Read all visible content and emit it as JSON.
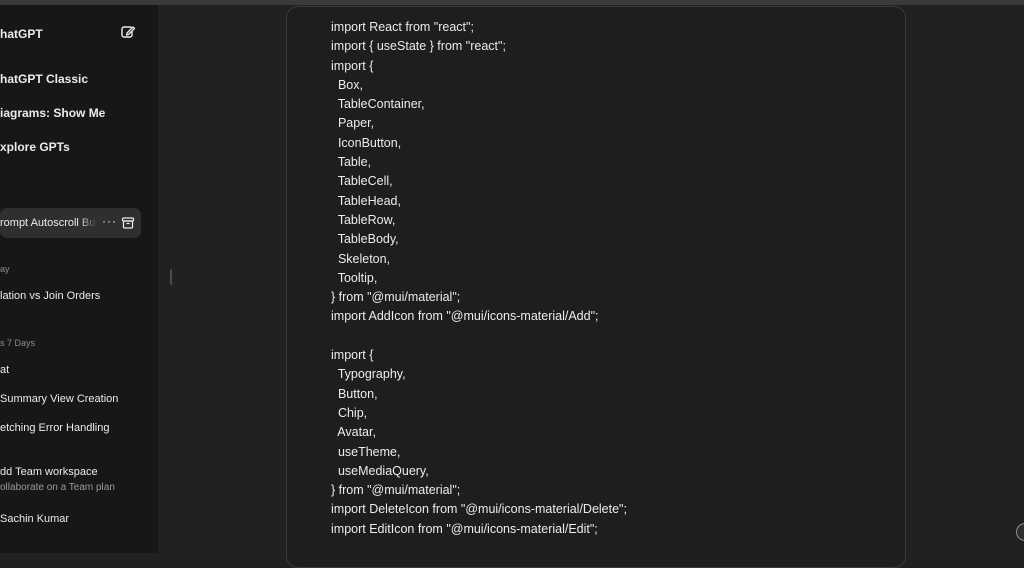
{
  "sidebar": {
    "title": "hatGPT",
    "new_chat_icon": "edit-icon",
    "gpts": [
      {
        "label": "hatGPT Classic"
      },
      {
        "label": "iagrams: Show Me"
      },
      {
        "label": "xplore GPTs"
      }
    ],
    "active_chat": {
      "label": "rompt Autoscroll Bu",
      "more": "···",
      "archive_icon": "archive-icon"
    },
    "sections": [
      {
        "heading": "ay",
        "items": [
          "lation vs Join Orders"
        ]
      },
      {
        "heading": "s 7 Days",
        "items": [
          "at",
          "Summary View Creation",
          "etching Error Handling"
        ]
      }
    ],
    "team": {
      "title": "dd Team workspace",
      "subtitle": "ollaborate on a Team plan"
    },
    "user": {
      "name": "Sachin Kumar"
    }
  },
  "code": {
    "lines": [
      "import React from \"react\";",
      "import { useState } from \"react\";",
      "import {",
      "  Box,",
      "  TableContainer,",
      "  Paper,",
      "  IconButton,",
      "  Table,",
      "  TableCell,",
      "  TableHead,",
      "  TableRow,",
      "  TableBody,",
      "  Skeleton,",
      "  Tooltip,",
      "} from \"@mui/material\";",
      "import AddIcon from \"@mui/icons-material/Add\";",
      "",
      "import {",
      "  Typography,",
      "  Button,",
      "  Chip,",
      "  Avatar,",
      "  useTheme,",
      "  useMediaQuery,",
      "} from \"@mui/material\";",
      "import DeleteIcon from \"@mui/icons-material/Delete\";",
      "import EditIcon from \"@mui/icons-material/Edit\";"
    ]
  }
}
